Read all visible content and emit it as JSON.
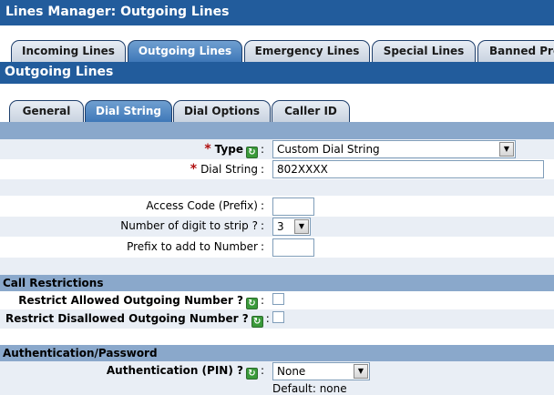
{
  "title": "Lines Manager:  Outgoing Lines",
  "tabs": [
    {
      "label": "Incoming Lines",
      "active": false
    },
    {
      "label": "Outgoing Lines",
      "active": true
    },
    {
      "label": "Emergency Lines",
      "active": false
    },
    {
      "label": "Special Lines",
      "active": false
    },
    {
      "label": "Banned Pre",
      "active": false
    }
  ],
  "section_title": "Outgoing Lines",
  "subtabs": [
    {
      "label": "General",
      "active": false
    },
    {
      "label": "Dial String",
      "active": true
    },
    {
      "label": "Dial Options",
      "active": false
    },
    {
      "label": "Caller ID",
      "active": false
    }
  ],
  "form": {
    "type_label": "Type",
    "type_value": "Custom Dial String",
    "dial_string_label": "Dial String",
    "dial_string_value": "802XXXX",
    "access_code_label": "Access Code (Prefix)",
    "access_code_value": "",
    "digits_strip_label": "Number of digit to strip ?",
    "digits_strip_value": "3",
    "prefix_add_label": "Prefix to add to Number",
    "prefix_add_value": ""
  },
  "call_restrictions": {
    "header": "Call Restrictions",
    "restrict_allowed_label": "Restrict Allowed Outgoing Number ?",
    "restrict_allowed_checked": false,
    "restrict_disallowed_label": "Restrict Disallowed Outgoing Number ?",
    "restrict_disallowed_checked": false
  },
  "authentication": {
    "header": "Authentication/Password",
    "pin_label": "Authentication (PIN) ?",
    "pin_value": "None",
    "default_text": "Default: none"
  },
  "symbols": {
    "required": "*",
    "colon": ":",
    "help": "↻",
    "dropdown": "▼"
  },
  "colors": {
    "header_blue": "#225c9c",
    "band_blue": "#8aa8cb",
    "row_alt": "#e9eef5",
    "required_red": "#b01010"
  }
}
